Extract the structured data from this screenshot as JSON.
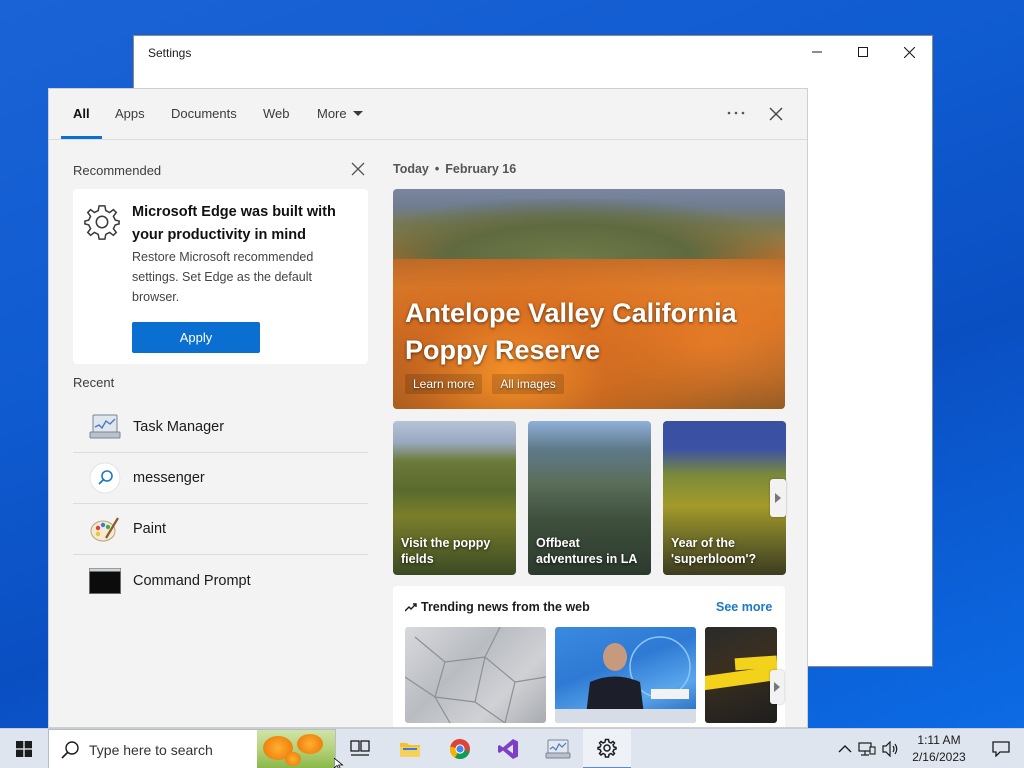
{
  "settings_window": {
    "title": "Settings"
  },
  "search_panel": {
    "tabs": [
      {
        "label": "All",
        "active": true
      },
      {
        "label": "Apps"
      },
      {
        "label": "Documents"
      },
      {
        "label": "Web"
      },
      {
        "label": "More"
      }
    ],
    "recommended": {
      "header": "Recommended",
      "card_title": "Microsoft Edge was built with your productivity in mind",
      "card_desc": "Restore Microsoft recommended settings. Set Edge as the default browser.",
      "apply_label": "Apply"
    },
    "recent": {
      "header": "Recent",
      "items": [
        {
          "label": "Task Manager",
          "icon": "task-manager-icon"
        },
        {
          "label": "messenger",
          "icon": "search-icon"
        },
        {
          "label": "Paint",
          "icon": "paint-icon"
        },
        {
          "label": "Command Prompt",
          "icon": "command-prompt-icon"
        }
      ]
    },
    "today": {
      "label": "Today",
      "date": "February 16"
    },
    "hero": {
      "title": "Antelope Valley California Poppy Reserve",
      "learn_more": "Learn more",
      "all_images": "All images"
    },
    "thumbs": [
      {
        "label": "Visit the poppy fields"
      },
      {
        "label": "Offbeat adventures in LA"
      },
      {
        "label": "Year of the 'superbloom'?"
      }
    ],
    "trending": {
      "title": "Trending news from the web",
      "see_more": "See more"
    }
  },
  "taskbar": {
    "search_placeholder": "Type here to search",
    "time": "1:11 AM",
    "date": "2/16/2023"
  },
  "colors": {
    "accent": "#0a6fd0",
    "link": "#1a79c8"
  }
}
